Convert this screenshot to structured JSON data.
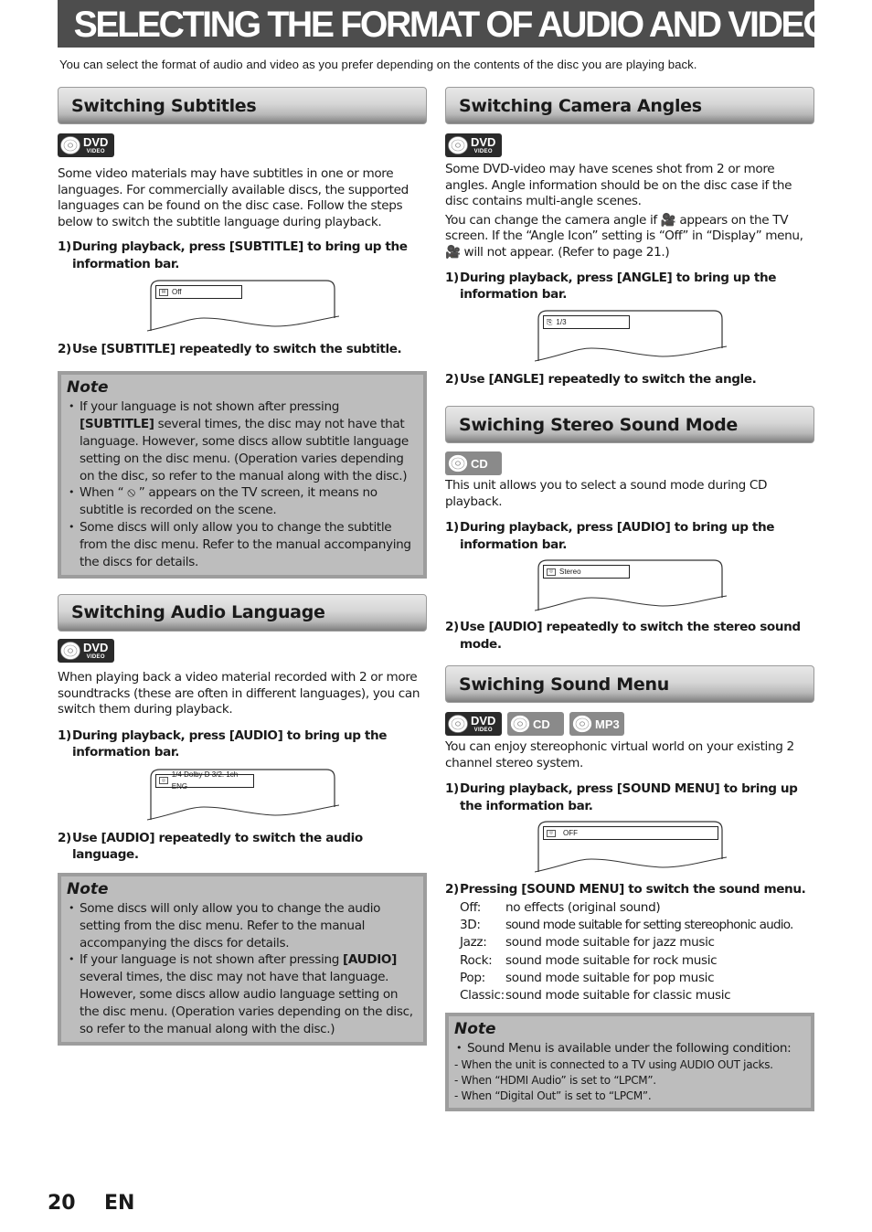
{
  "page": {
    "title": "SELECTING THE FORMAT OF AUDIO AND VIDEO",
    "intro": "You can select the format of audio and video as you prefer depending on the contents of the disc you are playing back.",
    "page_number": "20",
    "language": "EN"
  },
  "badges": {
    "dvd": "DVD",
    "dvd_sub": "VIDEO",
    "cd": "CD",
    "mp3": "MP3"
  },
  "subtitles": {
    "heading": "Switching Subtitles",
    "body": "Some video materials may have subtitles in one or more languages. For commercially available discs, the supported languages can be found on the disc case. Follow the steps below to switch the subtitle language during playback.",
    "step1_num": "1)",
    "step1": "During playback, press [SUBTITLE] to bring up the information bar.",
    "info_value": "Off",
    "step2_num": "2)",
    "step2": "Use [SUBTITLE] repeatedly to switch the subtitle.",
    "note": {
      "title": "Note",
      "items": [
        "If your language is not shown after pressing [SUBTITLE] several times, the disc may not have that language. However, some discs allow subtitle language setting on the disc menu. (Operation varies depending on the disc, so refer to the manual along with the disc.)",
        "When “ ⦸ ” appears on the TV screen, it means no subtitle is recorded on the scene.",
        "Some discs will only allow you to change the subtitle from the disc menu. Refer to the manual accompanying the discs for details."
      ]
    }
  },
  "audio_language": {
    "heading": "Switching Audio Language",
    "body": "When playing back a video material recorded with 2 or more soundtracks (these are often in different languages), you can switch them during playback.",
    "step1_num": "1)",
    "step1": "During playback, press [AUDIO] to bring up the information bar.",
    "info_value": "1/4 Dolby D 3/2. 1ch ENG",
    "step2_num": "2)",
    "step2": "Use [AUDIO] repeatedly to switch the audio language.",
    "note": {
      "title": "Note",
      "items": [
        "Some discs will only allow you to change the audio setting from the disc menu. Refer to the manual accompanying the discs for details.",
        "If your language is not shown after pressing [AUDIO] several times, the disc may not have that language. However, some discs allow audio language setting on the disc menu. (Operation varies depending on the disc, so refer to the manual along with the disc.)"
      ]
    }
  },
  "camera_angles": {
    "heading": "Switching Camera Angles",
    "body1": "Some DVD-video may have scenes shot from 2 or more angles. Angle information should be on the disc case if the disc contains multi-angle scenes.",
    "body2": "You can change the camera angle if 🎥 appears on the TV screen. If the “Angle Icon” setting is “Off” in “Display” menu, 🎥 will not appear. (Refer to page 21.)",
    "step1_num": "1)",
    "step1": "During playback, press [ANGLE] to bring up the information bar.",
    "info_value": "1/3",
    "step2_num": "2)",
    "step2": "Use [ANGLE] repeatedly to switch the angle."
  },
  "stereo_mode": {
    "heading": "Swiching Stereo Sound Mode",
    "body": "This unit allows you to select a sound mode during CD playback.",
    "step1_num": "1)",
    "step1": "During playback, press [AUDIO] to bring up the information bar.",
    "info_value": "Stereo",
    "step2_num": "2)",
    "step2": "Use [AUDIO] repeatedly to switch the stereo sound mode."
  },
  "sound_menu": {
    "heading": "Swiching Sound Menu",
    "body": "You can enjoy stereophonic virtual world on your existing 2 channel stereo system.",
    "step1_num": "1)",
    "step1": "During playback, press [SOUND MENU] to bring up the information bar.",
    "info_value": "OFF",
    "step2_num": "2)",
    "step2": "Pressing [SOUND MENU] to switch the sound menu.",
    "modes": [
      {
        "key": "Off:",
        "value": "no effects (original sound)"
      },
      {
        "key": "3D:",
        "value": "sound mode suitable for setting stereophonic audio."
      },
      {
        "key": "Jazz:",
        "value": "sound mode suitable for jazz music"
      },
      {
        "key": "Rock:",
        "value": "sound mode suitable for rock music"
      },
      {
        "key": "Pop:",
        "value": "sound mode suitable for pop music"
      },
      {
        "key": "Classic:",
        "value": "sound mode suitable for classic music"
      }
    ],
    "note": {
      "title": "Note",
      "item": "Sound Menu is available under the following condition:",
      "conditions": [
        "- When the unit is connected to a TV using AUDIO OUT jacks.",
        "- When “HDMI Audio” is set to “LPCM”.",
        "- When “Digital Out” is set to “LPCM”."
      ]
    }
  }
}
